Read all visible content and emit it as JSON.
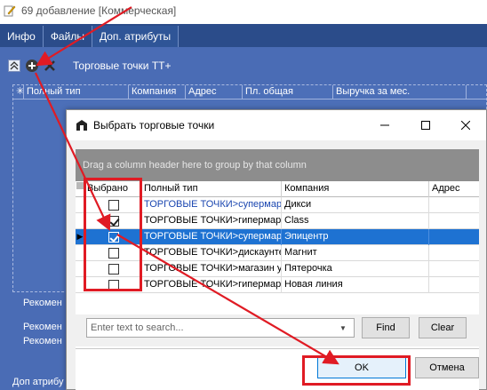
{
  "back_window": {
    "title": "69 добавление [Коммерческая]",
    "tabs": [
      {
        "label": "Инфо"
      },
      {
        "label": "Файлы"
      },
      {
        "label": "Доп. атрибуты"
      }
    ],
    "toolbar_label": "Торговые точки ТТ+",
    "grid_columns": [
      "Полный тип",
      "Компания",
      "Адрес",
      "Пл. общая",
      "Выручка за мес."
    ],
    "side_label_1": "Рекомен",
    "side_label_2": "Рекомен",
    "side_label_3": "Рекомен",
    "bottom_tab": "Доп атрибу"
  },
  "dialog": {
    "title": "Выбрать торговые точки",
    "group_panel_text": "Drag a column header here to group by that column",
    "columns": [
      "Выбрано",
      "Полный тип",
      "Компания",
      "Адрес"
    ],
    "rows": [
      {
        "checked": false,
        "type": "ТОРГОВЫЕ ТОЧКИ>супермарк",
        "company": "Дикси",
        "address": "",
        "selected": false,
        "type_blue": true
      },
      {
        "checked": true,
        "type": "ТОРГОВЫЕ ТОЧКИ>гипермарк",
        "company": "Class",
        "address": "",
        "selected": false,
        "type_blue": false
      },
      {
        "checked": true,
        "type": "ТОРГОВЫЕ ТОЧКИ>супермарк",
        "company": "Эпицентр",
        "address": "",
        "selected": true,
        "type_blue": false
      },
      {
        "checked": false,
        "type": "ТОРГОВЫЕ ТОЧКИ>дискаунте",
        "company": "Магнит",
        "address": "",
        "selected": false,
        "type_blue": false
      },
      {
        "checked": false,
        "type": "ТОРГОВЫЕ ТОЧКИ>магазин у ,",
        "company": "Пятерочка",
        "address": "",
        "selected": false,
        "type_blue": false
      },
      {
        "checked": false,
        "type": "ТОРГОВЫЕ ТОЧКИ>гипермарк",
        "company": "Новая линия",
        "address": "",
        "selected": false,
        "type_blue": false
      }
    ],
    "search": {
      "placeholder": "Enter text to search...",
      "value": ""
    },
    "find_label": "Find",
    "clear_label": "Clear",
    "ok_label": "OK",
    "cancel_label": "Отмена"
  },
  "colors": {
    "accent_red": "#e01b24",
    "selection_blue": "#1e72d2",
    "back_panel_blue": "#4a6cb5"
  }
}
